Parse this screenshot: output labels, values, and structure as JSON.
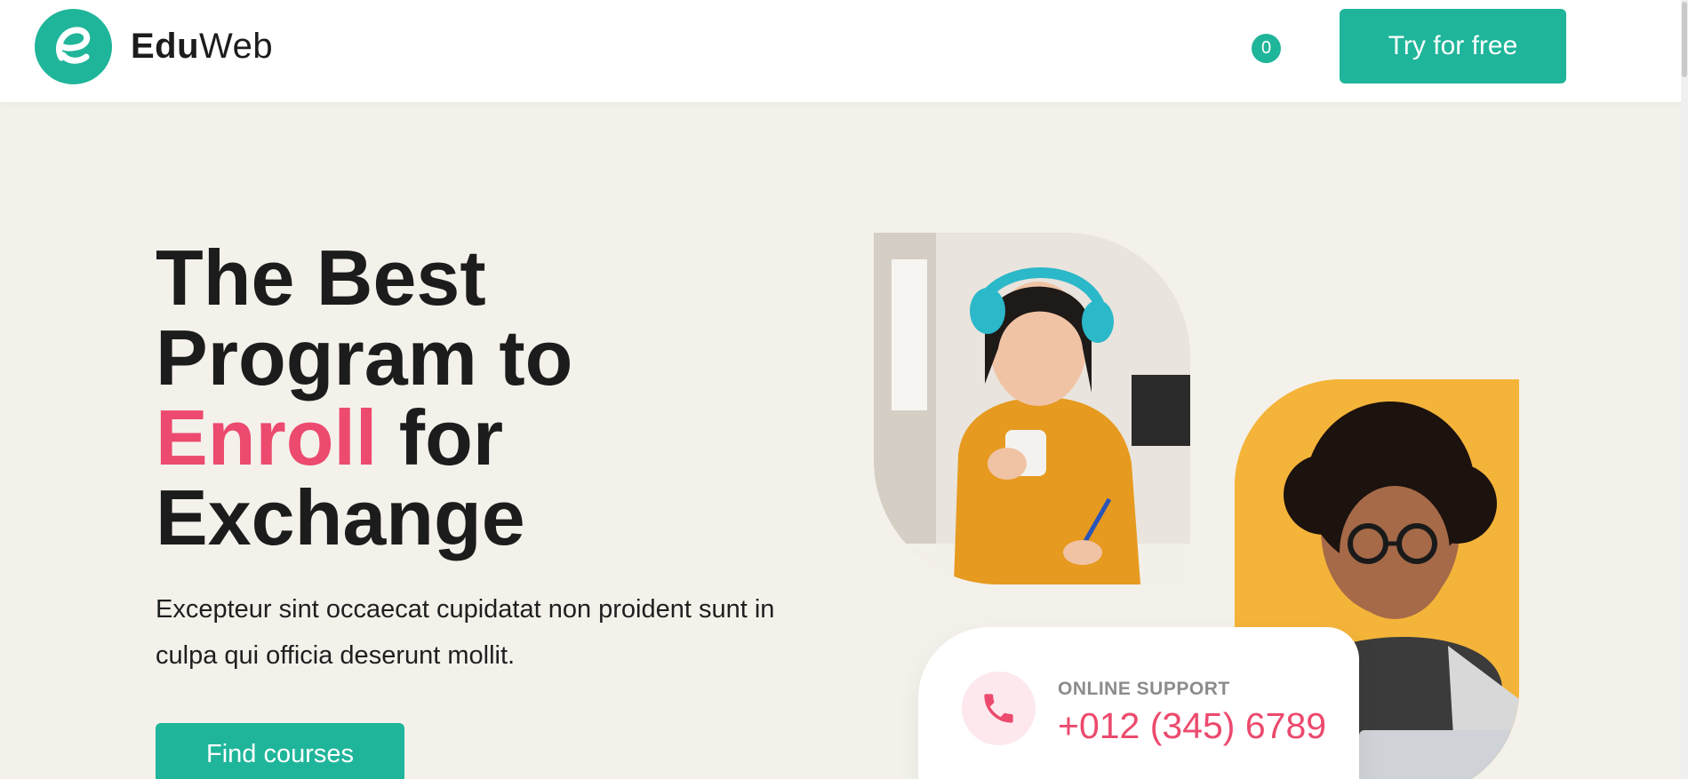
{
  "brand": {
    "name_bold": "Edu",
    "name_light": "Web",
    "logo_letter": "e",
    "primary_color": "#1fb59a",
    "accent_color": "#ec4a6e"
  },
  "header": {
    "cart_count": "0",
    "cta_label": "Try for free"
  },
  "hero": {
    "title_line1": "The Best",
    "title_line2": "Program to",
    "title_accent": "Enroll",
    "title_line3_rest": " for",
    "title_line4": "Exchange",
    "description": "Excepteur sint occaecat cupidatat non proident sunt in culpa qui officia deserunt mollit.",
    "cta_label": "Find courses"
  },
  "support": {
    "label": "ONLINE SUPPORT",
    "phone": "+012 (345) 6789",
    "icon": "phone-icon"
  }
}
